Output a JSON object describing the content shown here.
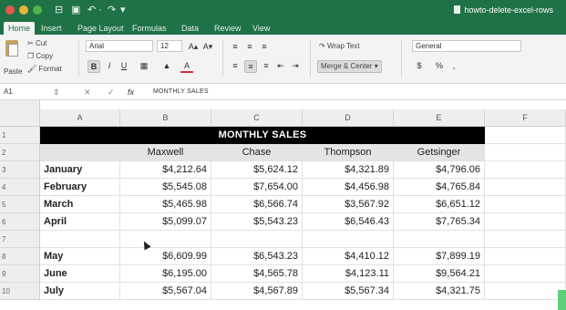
{
  "titlebar": {
    "doc_title": "howto-delete-excel-rows",
    "qa_icons": [
      "⊟",
      "▣",
      "↶ ·",
      "↷",
      "▾"
    ]
  },
  "tabs": [
    "Home",
    "Insert",
    "Page Layout",
    "Formulas",
    "Data",
    "Review",
    "View"
  ],
  "ribbon": {
    "paste_label": "Paste",
    "cut_label": "Cut",
    "copy_label": "Copy",
    "format_label": "Format",
    "font_name": "Arial",
    "font_size": "12",
    "bold": "B",
    "italic": "I",
    "underline": "U",
    "grow_font": "A▴",
    "shrink_font": "A▾",
    "wrap_text": "Wrap Text",
    "merge_center": "Merge & Center",
    "number_format": "General",
    "currency": "$",
    "percent": "%",
    "comma": ",",
    "align_symbols": [
      "≡",
      "≡",
      "≡",
      "⇤",
      "⇥"
    ]
  },
  "formula_bar": {
    "name_box": "A1",
    "fx": "fx",
    "content": "MONTHLY SALES"
  },
  "columns": [
    "A",
    "B",
    "C",
    "D",
    "E",
    "F"
  ],
  "row_numbers": [
    "1",
    "2",
    "3",
    "4",
    "5",
    "6",
    "7",
    "8",
    "9",
    "10"
  ],
  "sheet": {
    "title": "MONTHLY SALES",
    "headers": [
      "Maxwell",
      "Chase",
      "Thompson",
      "Getsinger"
    ],
    "rows": [
      {
        "month": "January",
        "values": [
          "$4,212.64",
          "$5,624.12",
          "$4,321.89",
          "$4,796.06"
        ]
      },
      {
        "month": "February",
        "values": [
          "$5,545.08",
          "$7,654.00",
          "$4,456.98",
          "$4,765.84"
        ]
      },
      {
        "month": "March",
        "values": [
          "$5,465.98",
          "$6,566.74",
          "$3,567.92",
          "$6,651.12"
        ]
      },
      {
        "month": "April",
        "values": [
          "$5,099.07",
          "$5,543.23",
          "$6,546.43",
          "$7,765.34"
        ]
      },
      {
        "month": "",
        "values": [
          "",
          "",
          "",
          ""
        ]
      },
      {
        "month": "May",
        "values": [
          "$6,609.99",
          "$6,543.23",
          "$4,410.12",
          "$7,899.19"
        ]
      },
      {
        "month": "June",
        "values": [
          "$6,195.00",
          "$4,565.78",
          "$4,123.11",
          "$9,564.21"
        ]
      },
      {
        "month": "July",
        "values": [
          "$5,567.04",
          "$4,567.89",
          "$5,567.34",
          "$4,321.75"
        ]
      }
    ]
  },
  "colors": {
    "excel_green": "#1f7246",
    "title_fill": "#000000",
    "header_fill": "#e4e4e4"
  }
}
